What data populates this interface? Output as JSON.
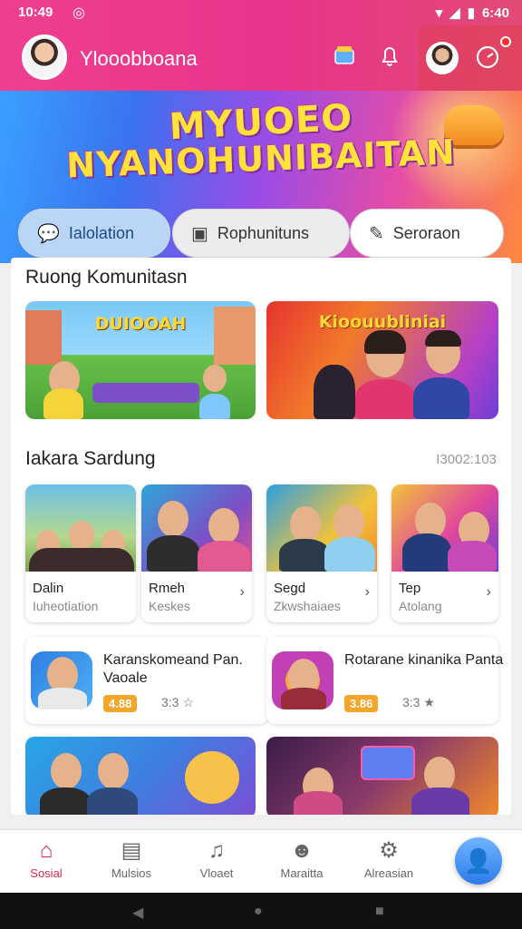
{
  "status": {
    "time": "10:49",
    "app_icon": "status-app-icon",
    "right_text": "6:40"
  },
  "header": {
    "username": "Ylooobboana",
    "icons": [
      "gift-icon",
      "bell-icon",
      "profile-avatar",
      "timer-icon"
    ]
  },
  "banner": {
    "title_line1": "MYUOEO",
    "title_line2": "NYANOHUNIBAITAN"
  },
  "tabs": [
    {
      "label": "Ialolation",
      "icon": "chat-bubble-icon"
    },
    {
      "label": "Rophunituns",
      "icon": "photo-frame-icon"
    },
    {
      "label": "Seroraon",
      "icon": "pen-icon"
    }
  ],
  "community": {
    "title": "Ruong Komunitasn",
    "cards": [
      {
        "label": "DUIOOAH"
      },
      {
        "label": "Kioouubliniai"
      }
    ]
  },
  "stories_section": {
    "title": "Iakara Sardung",
    "side_text": "I3002:103",
    "stories": [
      {
        "title": "Dalin",
        "subtitle": "Iuheotiation"
      },
      {
        "title": "Rmeh",
        "subtitle": "Keskes"
      },
      {
        "title": "Segd",
        "subtitle": "Zkwshaiaes"
      },
      {
        "title": "Tep",
        "subtitle": "Atolang"
      }
    ]
  },
  "info_cards": [
    {
      "title": "Karanskomeand Pan. Vaoale",
      "price": "4.88",
      "meta": "3:3 ☆"
    },
    {
      "title": "Rotarane kinanika Panta",
      "price": "3.86",
      "meta": "3:3 ★"
    }
  ],
  "bottom_nav": [
    {
      "label": "Sosial",
      "icon": "home-icon",
      "active": true
    },
    {
      "label": "Mulsios",
      "icon": "clipboard-icon",
      "active": false
    },
    {
      "label": "Vloaet",
      "icon": "music-icon",
      "active": false
    },
    {
      "label": "Maraitta",
      "icon": "group-icon",
      "active": false
    },
    {
      "label": "Alreasian",
      "icon": "settings-icon",
      "active": false
    }
  ],
  "colors": {
    "header": "#e8358a",
    "tab_active": "#b9d6f7",
    "nav_active": "#e02a4a",
    "price_badge": "#f4a62a"
  }
}
